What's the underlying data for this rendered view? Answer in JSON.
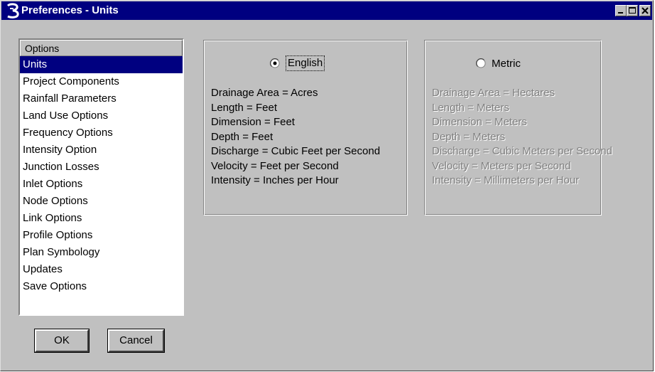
{
  "window": {
    "title": "Preferences - Units",
    "app_icon": "gen-logo-icon",
    "buttons": [
      "minimize-icon",
      "maximize-icon",
      "close-icon"
    ]
  },
  "options_list": {
    "header": "Options",
    "selected_index": 0,
    "items": [
      "Units",
      "Project Components",
      "Rainfall Parameters",
      "Land Use Options",
      "Frequency Options",
      "Intensity Option",
      "Junction Losses",
      "Inlet Options",
      "Node Options",
      "Link Options",
      "Profile Options",
      "Plan Symbology",
      "Updates",
      "Save Options"
    ]
  },
  "buttons": {
    "ok": "OK",
    "cancel": "Cancel"
  },
  "english": {
    "label": "English",
    "selected": true,
    "lines": [
      "Drainage Area = Acres",
      "Length = Feet",
      "Dimension = Feet",
      "Depth = Feet",
      "Discharge = Cubic Feet per Second",
      "Velocity = Feet per Second",
      "Intensity = Inches per Hour"
    ]
  },
  "metric": {
    "label": "Metric",
    "selected": false,
    "lines": [
      "Drainage Area = Hectares",
      "Length = Meters",
      "Dimension = Meters",
      "Depth = Meters",
      "Discharge = Cubic Meters per Second",
      "Velocity = Meters per Second",
      "Intensity = Millimeters per Hour"
    ]
  },
  "colors": {
    "titlebar": "#000080",
    "window_bg": "#c0c0c0",
    "selection": "#000080",
    "disabled_text": "#808080"
  }
}
